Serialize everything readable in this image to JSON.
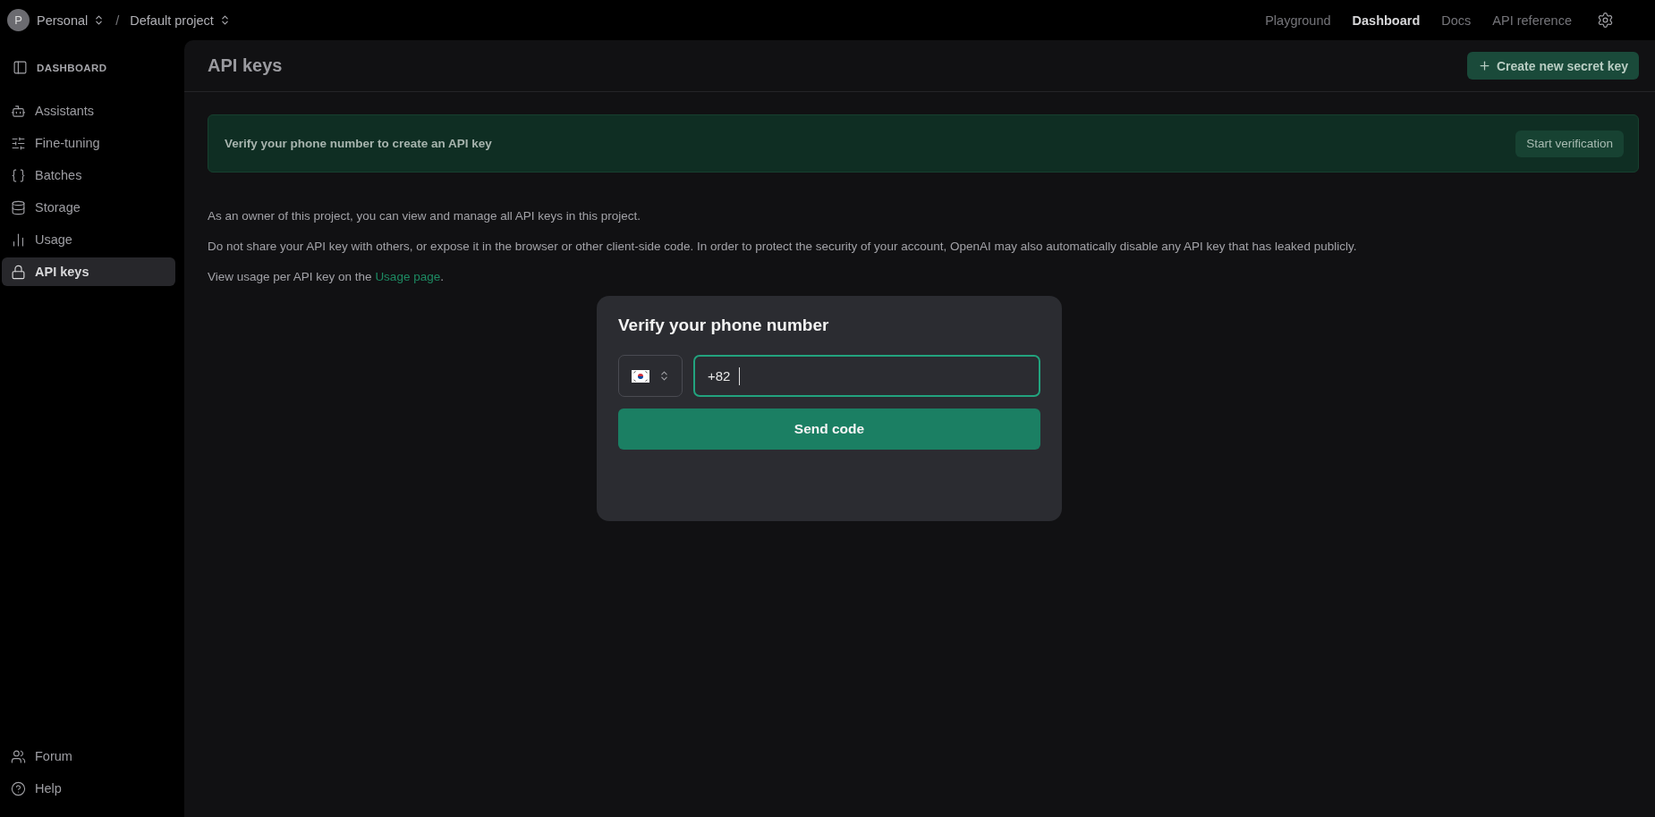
{
  "workspace": {
    "avatar": "P",
    "org": "Personal",
    "separator": "/",
    "project": "Default project"
  },
  "top_nav": [
    {
      "label": "Playground",
      "selected": false
    },
    {
      "label": "Dashboard",
      "selected": true
    },
    {
      "label": "Docs",
      "selected": false
    },
    {
      "label": "API reference",
      "selected": false
    }
  ],
  "sidebar": {
    "heading": "DASHBOARD",
    "items": [
      {
        "label": "Assistants",
        "selected": false
      },
      {
        "label": "Fine-tuning",
        "selected": false
      },
      {
        "label": "Batches",
        "selected": false
      },
      {
        "label": "Storage",
        "selected": false
      },
      {
        "label": "Usage",
        "selected": false
      },
      {
        "label": "API keys",
        "selected": true
      }
    ],
    "footer_items": [
      {
        "label": "Forum"
      },
      {
        "label": "Help"
      }
    ]
  },
  "page": {
    "title": "API keys",
    "create_button": "Create new secret key",
    "banner": {
      "message": "Verify your phone number to create an API key",
      "button": "Start verification"
    },
    "paragraphs": [
      {
        "text": "As an owner of this project, you can view and manage all API keys in this project."
      },
      {
        "text": "Do not share your API key with others, or expose it in the browser or other client-side code. In order to protect the security of your account, OpenAI may also automatically disable any API key that has leaked publicly."
      },
      {
        "text": "View usage per API key on the ",
        "link": "Usage page",
        "after": "."
      }
    ]
  },
  "dialog": {
    "title": "Verify your phone number",
    "phone": {
      "value": "+82",
      "focused": true
    },
    "button": "Send code"
  }
}
